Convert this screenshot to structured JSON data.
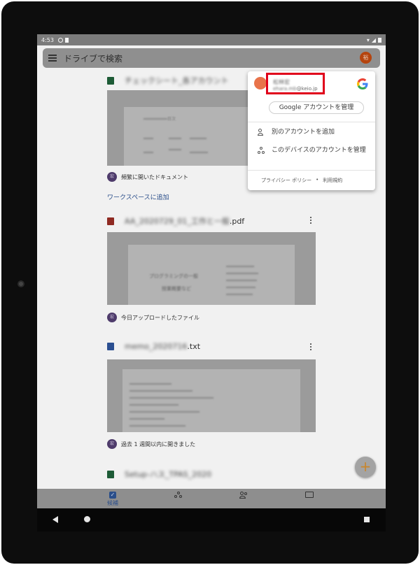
{
  "status_bar": {
    "time": "4:53"
  },
  "search": {
    "placeholder": "ドライブで検索",
    "avatar_initial": "裕"
  },
  "files": [
    {
      "name": "チェックシート_各アカウント",
      "name_suffix": "",
      "reason": "頻繁に開いたドキュメント",
      "reason_badge": "宏"
    },
    {
      "name": "AA_2020729_01_工作と一般",
      "name_suffix": ".pdf",
      "reason": "今日アップロードしたファイル",
      "reason_badge": "宏"
    },
    {
      "name": "memo_2020716",
      "name_suffix": ".txt",
      "reason": "過去 1 週間以内に開きました",
      "reason_badge": "宏"
    },
    {
      "name": "Setup-ハス_TPAS_2020",
      "name_suffix": ""
    }
  ],
  "add_workspace": "ワークスペースに追加",
  "thumb_texts": {
    "doc1_label": "目次",
    "pdf_line1": "プログラミングの一般",
    "pdf_line2": "授業概要など"
  },
  "bottom_nav": [
    {
      "label": "候補"
    },
    {
      "label": ""
    },
    {
      "label": ""
    },
    {
      "label": ""
    }
  ],
  "account_popup": {
    "name": "松林宏",
    "email_user": "ehara.mb",
    "email_domain": "@keio.jp",
    "manage_button": "Google アカウントを管理",
    "add_account": "別のアカウントを追加",
    "manage_device_accounts": "このデバイスのアカウントを管理",
    "privacy_policy": "プライバシー ポリシー",
    "separator": "•",
    "terms": "利用規約"
  },
  "colors": {
    "highlight_box": "#e0001b",
    "google_blue": "#4285F4",
    "google_red": "#EA4335",
    "google_yellow": "#FBBC05",
    "google_green": "#34A853"
  }
}
